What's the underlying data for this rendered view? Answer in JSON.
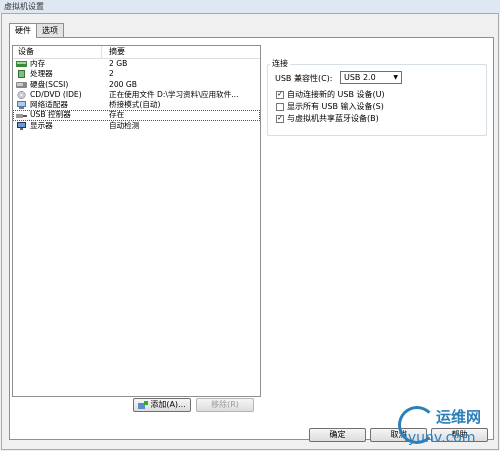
{
  "window": {
    "title": "虚拟机设置"
  },
  "tabs": [
    {
      "label": "硬件"
    },
    {
      "label": "选项"
    }
  ],
  "device_list": {
    "headers": {
      "device": "设备",
      "summary": "摘要"
    },
    "rows": [
      {
        "device": "内存",
        "summary": "2 GB",
        "icon": "memory-icon"
      },
      {
        "device": "处理器",
        "summary": "2",
        "icon": "processor-icon"
      },
      {
        "device": "硬盘(SCSI)",
        "summary": "200 GB",
        "icon": "hard-disk-icon"
      },
      {
        "device": "CD/DVD (IDE)",
        "summary": "正在使用文件 D:\\学习资料\\应用软件...",
        "icon": "cd-dvd-icon"
      },
      {
        "device": "网络适配器",
        "summary": "桥接模式(自动)",
        "icon": "network-adapter-icon"
      },
      {
        "device": "USB 控制器",
        "summary": "存在",
        "icon": "usb-controller-icon"
      },
      {
        "device": "显示器",
        "summary": "自动检测",
        "icon": "display-icon"
      }
    ],
    "selected_index": 5
  },
  "list_buttons": {
    "add": "添加(A)...",
    "remove": "移除(R)"
  },
  "connection": {
    "group_title": "连接",
    "usb_compat_label": "USB 兼容性(C):",
    "usb_compat_value": "USB 2.0",
    "checkboxes": [
      {
        "label": "自动连接新的 USB 设备(U)",
        "checked": true
      },
      {
        "label": "显示所有 USB 输入设备(S)",
        "checked": false
      },
      {
        "label": "与虚拟机共享蓝牙设备(B)",
        "checked": true
      }
    ]
  },
  "footer": {
    "ok": "确定",
    "cancel": "取消",
    "help": "帮助"
  },
  "watermark": {
    "cn": "运维网",
    "en": "iyunv.com"
  }
}
